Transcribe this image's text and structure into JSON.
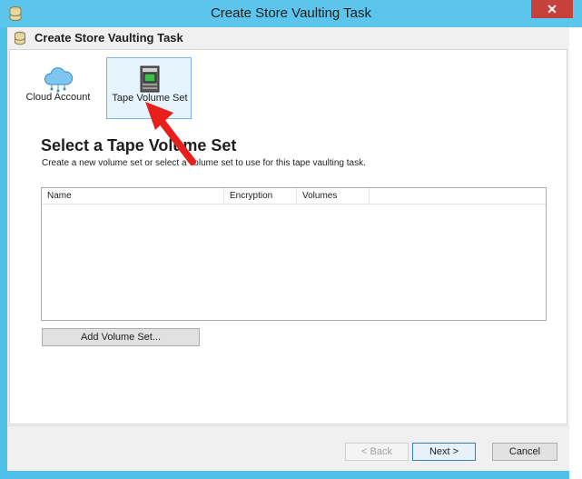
{
  "window": {
    "title": "Create Store Vaulting Task",
    "close_glyph": "✕"
  },
  "header": {
    "title": "Create Store Vaulting Task"
  },
  "nav": {
    "items": [
      {
        "label": "Cloud Account",
        "icon": "cloud-icon",
        "selected": false
      },
      {
        "label": "Tape Volume Set",
        "icon": "tape-library-icon",
        "selected": true
      }
    ]
  },
  "main": {
    "title": "Select a Tape Volume Set",
    "description": "Create a new volume set or select a volume set to use for this tape vaulting task.",
    "table": {
      "columns": [
        "Name",
        "Encryption",
        "Volumes"
      ],
      "rows": []
    },
    "add_button": "Add Volume Set..."
  },
  "footer": {
    "back_label": "< Back",
    "next_label": "Next >",
    "cancel_label": "Cancel"
  },
  "colors": {
    "titlebar": "#5bc5ec",
    "close": "#c7413c",
    "selected_border": "#7eb4ea",
    "arrow": "#e8201c"
  }
}
